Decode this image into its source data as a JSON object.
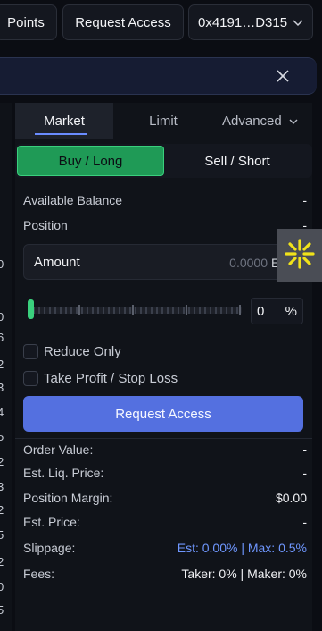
{
  "topbar": {
    "points_label": "Points",
    "request_access_label": "Request Access",
    "wallet_address": "0x4191…D315"
  },
  "left_strip": {
    "numbers": [
      "0",
      "0",
      "6",
      "2",
      "3",
      "4",
      "5",
      "2",
      "3",
      "2",
      "5",
      "2",
      "0",
      "5"
    ]
  },
  "tabs": {
    "market": "Market",
    "limit": "Limit",
    "advanced": "Advanced"
  },
  "side": {
    "buy_label": "Buy / Long",
    "sell_label": "Sell / Short"
  },
  "info_top": {
    "available_balance_label": "Available Balance",
    "available_balance_value": "-",
    "position_label": "Position",
    "position_value": "-"
  },
  "amount": {
    "label": "Amount",
    "placeholder": "0.0000",
    "unit": "ETH"
  },
  "slider": {
    "value": 0,
    "percent_text": "0",
    "percent_symbol": "%"
  },
  "options": {
    "reduce_only": "Reduce Only",
    "tp_sl": "Take Profit / Stop Loss"
  },
  "action": {
    "request_access_label": "Request Access"
  },
  "summary": {
    "order_value_label": "Order Value:",
    "order_value": "-",
    "liq_price_label": "Est. Liq. Price:",
    "liq_price": "-",
    "position_margin_label": "Position Margin:",
    "position_margin": "$0.00",
    "est_price_label": "Est. Price:",
    "est_price": "-",
    "slippage_label": "Slippage:",
    "slippage_value": "Est: 0.00% | Max: 0.5%",
    "fees_label": "Fees:",
    "fees_value": "Taker: 0% | Maker: 0%"
  },
  "colors": {
    "accent_green": "#1f9a56",
    "accent_blue": "#5470e0",
    "link_blue": "#6f97ff",
    "floating_icon": "#f0e21a"
  },
  "icons": {
    "close": "close-icon",
    "chevron": "chevron-down-icon",
    "sparkle": "sparkle-icon"
  }
}
